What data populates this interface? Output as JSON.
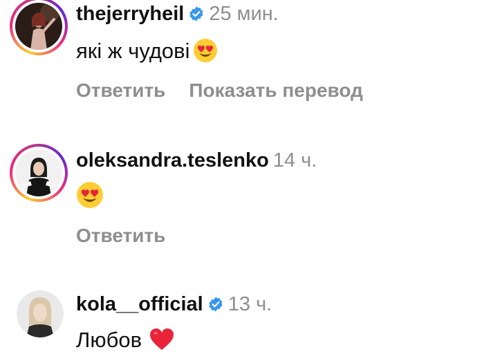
{
  "comments": [
    {
      "username": "thejerryheil",
      "verified": true,
      "time": "25 мин.",
      "text": "які ж чудові",
      "emoji": "heart-eyes-emoji",
      "reply_label": "Ответить",
      "translate_label": "Показать перевод"
    },
    {
      "username": "oleksandra.teslenko",
      "verified": false,
      "time": "14 ч.",
      "text": "",
      "emoji": "heart-eyes-emoji",
      "reply_label": "Ответить"
    },
    {
      "username": "kola__official",
      "verified": true,
      "time": "13 ч.",
      "text": "Любов",
      "emoji": "red-heart-emoji"
    }
  ],
  "colors": {
    "verified_badge": "#3797f0",
    "secondary_text": "#8e8e8e",
    "story_ring_start": "#f9ce34",
    "story_ring_end": "#6228d7"
  }
}
